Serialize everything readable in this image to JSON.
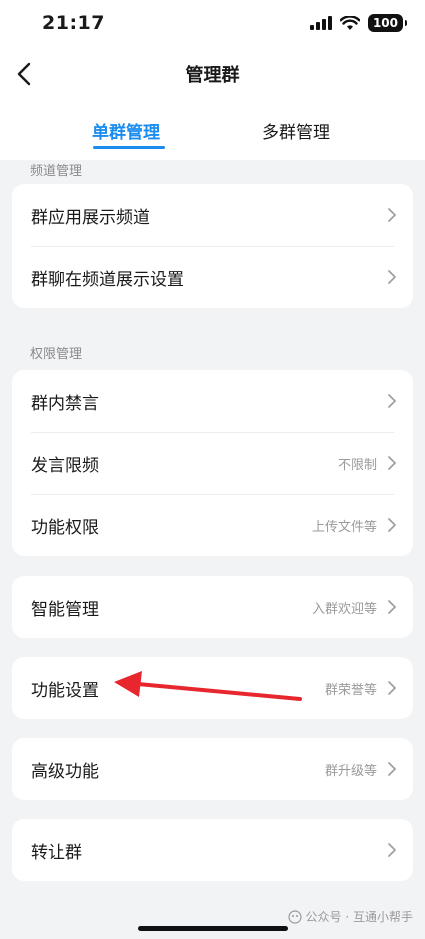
{
  "status_bar": {
    "time": "21:17",
    "battery": "100"
  },
  "nav": {
    "title": "管理群"
  },
  "tabs": [
    {
      "label": "单群管理",
      "active": true
    },
    {
      "label": "多群管理",
      "active": false
    }
  ],
  "sections": {
    "channel": {
      "label": "频道管理",
      "rows": [
        {
          "label": "群应用展示频道",
          "value": ""
        },
        {
          "label": "群聊在频道展示设置",
          "value": ""
        }
      ]
    },
    "permission": {
      "label": "权限管理",
      "rows": [
        {
          "label": "群内禁言",
          "value": ""
        },
        {
          "label": "发言限频",
          "value": "不限制"
        },
        {
          "label": "功能权限",
          "value": "上传文件等"
        }
      ]
    },
    "smart": {
      "label": "智能管理",
      "value": "入群欢迎等"
    },
    "feature": {
      "label": "功能设置",
      "value": "群荣誉等"
    },
    "advanced": {
      "label": "高级功能",
      "value": "群升级等"
    },
    "transfer": {
      "label": "转让群",
      "value": ""
    }
  },
  "watermark": "公众号 · 互通小帮手",
  "colors": {
    "accent": "#1a8cf0",
    "annotation_arrow": "#e8262e",
    "background": "#f2f3f5"
  }
}
